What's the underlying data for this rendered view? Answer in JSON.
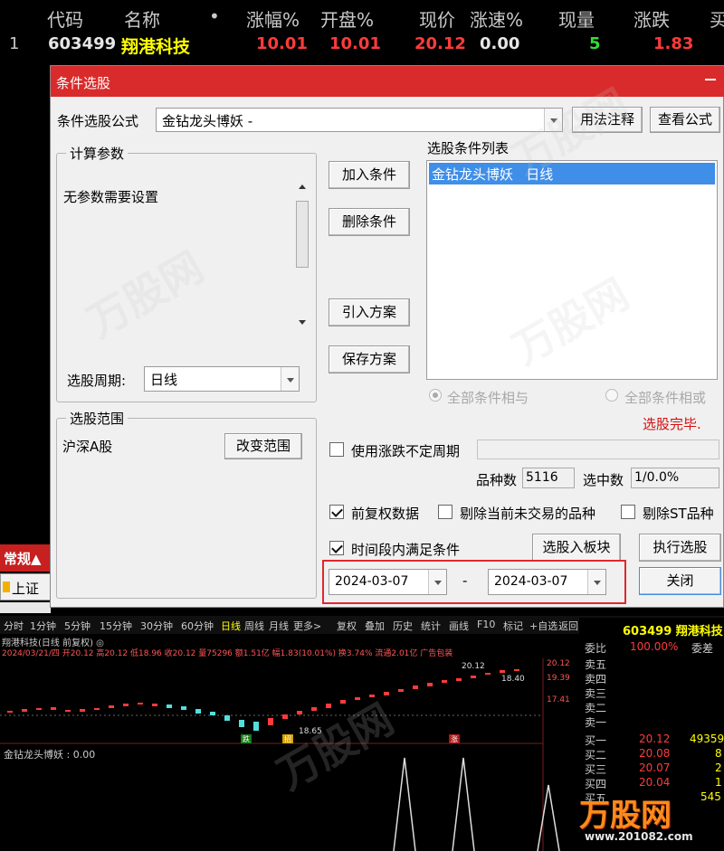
{
  "quote_header": {
    "columns": [
      "代码",
      "名称",
      "•",
      "涨幅%",
      "开盘%",
      "现价",
      "涨速%",
      "现量",
      "涨跌",
      "买"
    ]
  },
  "quote_row": {
    "index": "1",
    "code": "603499",
    "name": "翔港科技",
    "change_pct": "10.01",
    "open_pct": "10.01",
    "price": "20.12",
    "speed_pct": "0.00",
    "volume": "5",
    "change": "1.83"
  },
  "dialog": {
    "title": "条件选股",
    "formula_label": "条件选股公式",
    "formula_value": "金钻龙头博妖 -",
    "usage_button": "用法注释",
    "view_formula_button": "查看公式",
    "params_group": "计算参数",
    "params_text": "无参数需要设置",
    "period_label": "选股周期:",
    "period_value": "日线",
    "range_group": "选股范围",
    "range_value": "沪深A股",
    "change_range_button": "改变范围",
    "add_condition_button": "加入条件",
    "delete_condition_button": "删除条件",
    "import_plan_button": "引入方案",
    "save_plan_button": "保存方案",
    "condition_list_label": "选股条件列表",
    "condition_list_items": [
      "金钻龙头博妖   日线"
    ],
    "radio_and": "全部条件相与",
    "radio_or": "全部条件相或",
    "status_text": "选股完毕.",
    "use_variable_period": "使用涨跌不定周期",
    "variety_count_label": "品种数",
    "variety_count_value": "5116",
    "selected_count_label": "选中数",
    "selected_count_value": "1/0.0%",
    "forward_adj": "前复权数据",
    "exclude_not_trading": "剔除当前未交易的品种",
    "exclude_st": "剔除ST品种",
    "time_range_check": "时间段内满足条件",
    "to_board_button": "选股入板块",
    "execute_button": "执行选股",
    "close_button": "关闭",
    "date_start": "2024-03-07",
    "date_sep": "-",
    "date_end": "2024-03-07",
    "checked": {
      "use_variable_period": false,
      "forward_adj": true,
      "exclude_not_trading": false,
      "exclude_st": false,
      "time_range_check": true
    }
  },
  "side_panel": {
    "tab_label": "常规▲",
    "market_label": "上证"
  },
  "chart_toolbar": {
    "periods": [
      "分时",
      "1分钟",
      "5分钟",
      "15分钟",
      "30分钟",
      "60分钟",
      "日线",
      "周线",
      "月线",
      "更多>"
    ],
    "tools": [
      "复权",
      "叠加",
      "历史",
      "统计",
      "画线",
      "F10",
      "标记",
      "+自选",
      "返回"
    ]
  },
  "chart_info": {
    "line1": "翔港科技(日线 前复权) ◎",
    "line2": "2024/03/21/四 开20.12 高20.12 低18.96 收20.12 量75296 额1.51亿 幅1.83(10.01%) 换3.74% 流通2.01亿 广告包装",
    "indicator": "金钻龙头博妖 : 0.00",
    "price_labels": [
      "20.12",
      "19.39",
      "18.40",
      "18.65",
      "17.41"
    ],
    "badges": [
      "跌",
      "招",
      "涨"
    ]
  },
  "right_panel": {
    "code_name": "603499 翔港科技",
    "wei_bi_label": "委比",
    "wei_bi_value": "100.00%",
    "wei_cha_label": "委差",
    "sell_levels": [
      "卖五",
      "卖四",
      "卖三",
      "卖二",
      "卖一"
    ],
    "buy_levels": [
      {
        "label": "买一",
        "price": "20.12",
        "vol": "49359"
      },
      {
        "label": "买二",
        "price": "20.08",
        "vol": "8"
      },
      {
        "label": "买三",
        "price": "20.07",
        "vol": "2"
      },
      {
        "label": "买四",
        "price": "20.04",
        "vol": "1"
      },
      {
        "label": "买五",
        "price": "",
        "vol": "545"
      }
    ]
  },
  "watermark_brand": "万股网",
  "watermark_url": "www.201082.com",
  "colors": {
    "title_red": "#d92b2b",
    "up_red": "#ff3b3b",
    "highlight_yellow": "#ffff00",
    "list_select": "#3f8ee8"
  }
}
